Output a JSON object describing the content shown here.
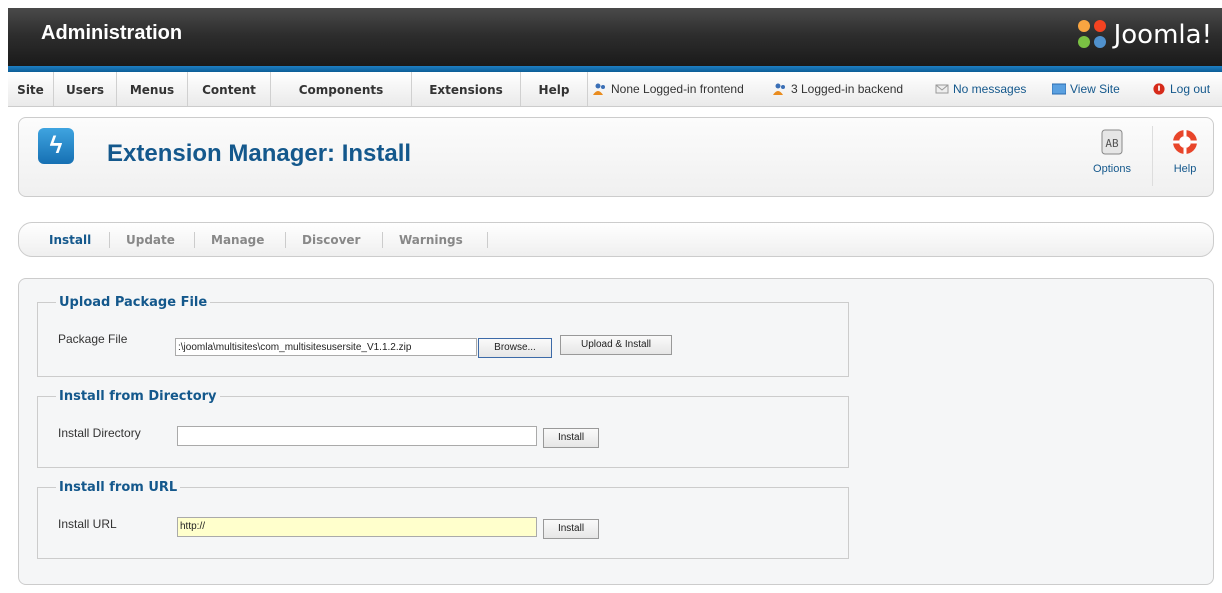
{
  "header": {
    "title": "Administration",
    "logo_text": "Joomla!"
  },
  "menu": {
    "items": [
      "Site",
      "Users",
      "Menus",
      "Content",
      "Components",
      "Extensions",
      "Help"
    ]
  },
  "status": {
    "frontend": "None Logged-in frontend",
    "backend": "3 Logged-in backend",
    "messages": "No messages",
    "view_site": "View Site",
    "logout": "Log out"
  },
  "toolbar": {
    "title": "Extension Manager: Install",
    "options_label": "Options",
    "help_label": "Help"
  },
  "tabs": [
    "Install",
    "Update",
    "Manage",
    "Discover",
    "Warnings"
  ],
  "upload": {
    "legend": "Upload Package File",
    "label": "Package File",
    "value": ":\\joomla\\multisites\\com_multisitesusersite_V1.1.2.zip",
    "browse": "Browse...",
    "submit": "Upload & Install"
  },
  "directory": {
    "legend": "Install from Directory",
    "label": "Install Directory",
    "value": "",
    "submit": "Install"
  },
  "url": {
    "legend": "Install from URL",
    "label": "Install URL",
    "value": "http://",
    "submit": "Install"
  },
  "colors": {
    "accent": "#14588c",
    "header_bar": "#1d7fc3"
  }
}
